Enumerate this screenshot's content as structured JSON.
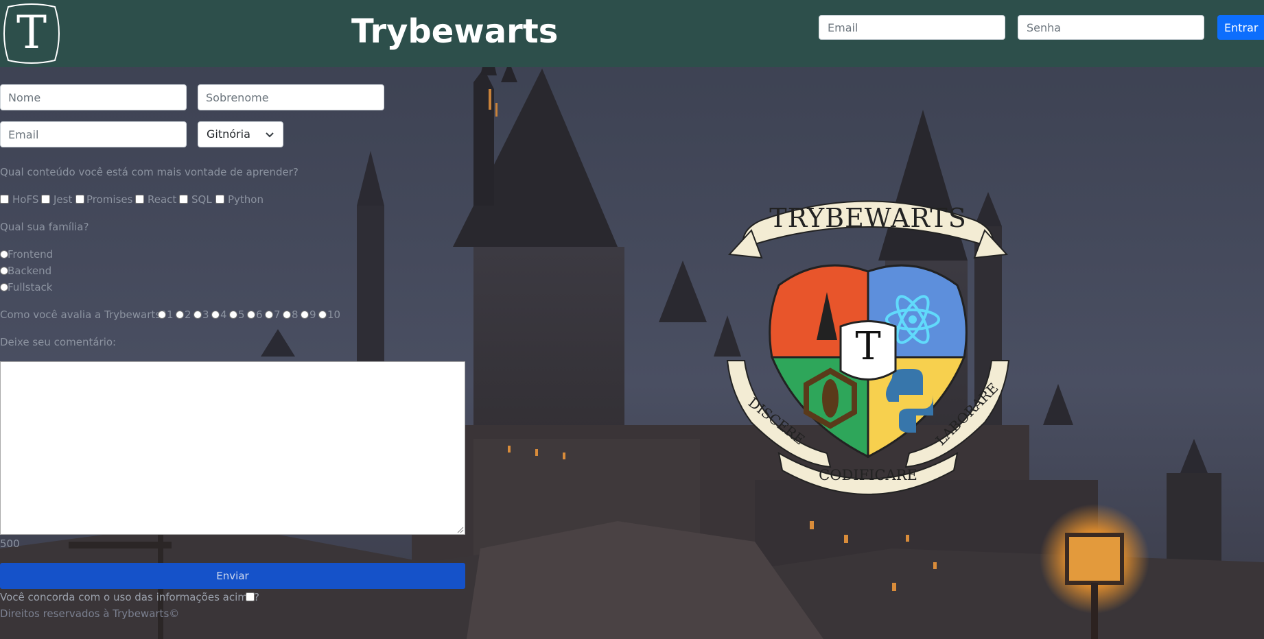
{
  "header": {
    "logo_letter": "T",
    "title": "Trybewarts",
    "email_placeholder": "Email",
    "password_placeholder": "Senha",
    "login_button": "Entrar"
  },
  "form": {
    "name_placeholder": "Nome",
    "lastname_placeholder": "Sobrenome",
    "email_placeholder": "Email",
    "house_select_value": "Gitnória",
    "content_question": "Qual conteúdo você está com mais vontade de aprender?",
    "content_options": [
      "HoFS",
      "Jest",
      "Promises",
      "React",
      "SQL",
      "Python"
    ],
    "family_question": "Qual sua família?",
    "family_options": [
      "Frontend",
      "Backend",
      "Fullstack"
    ],
    "rating_question": "Como você avalia a Trybewarts?",
    "rating_options": [
      "1",
      "2",
      "3",
      "4",
      "5",
      "6",
      "7",
      "8",
      "9",
      "10"
    ],
    "comment_label": "Deixe seu comentário:",
    "char_counter": "500",
    "submit_button": "Enviar",
    "agreement_label": "Você concorda com o uso das informações acima?",
    "footer_text": "Direitos reservados à Trybewarts©"
  },
  "crest": {
    "banner_top": "TRYBEWARTS",
    "center_letter": "T",
    "motto_left": "DISCERE",
    "motto_center": "CODIFICARE",
    "motto_right": "LABORARE"
  },
  "colors": {
    "header_bg": "#2d4f4b",
    "primary_button": "#0d6efd",
    "crest_red": "#e8552b",
    "crest_blue": "#5d8fdc",
    "crest_green": "#2ea65a",
    "crest_yellow": "#f7d04e"
  }
}
